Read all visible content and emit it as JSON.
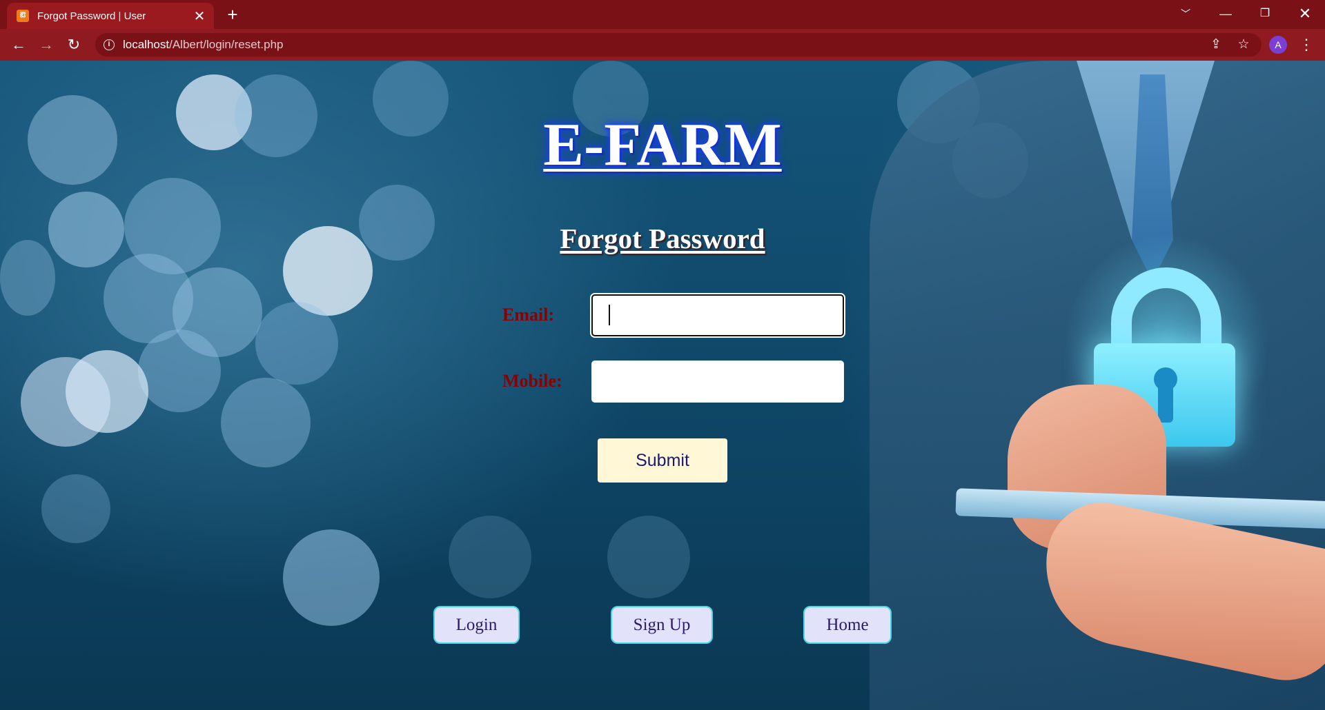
{
  "browser": {
    "tab_title": "Forgot Password | User",
    "tab_close": "✕",
    "new_tab": "+",
    "url_host": "localhost",
    "url_path": "/Albert/login/reset.php",
    "profile_initial": "A",
    "icons": [
      "back-icon",
      "forward-icon",
      "reload-icon",
      "site-info-icon",
      "share-icon",
      "bookmark-star-icon",
      "menu-dots-icon",
      "tab-search-icon",
      "minimize-icon",
      "restore-icon",
      "close-window-icon"
    ],
    "colors": {
      "tabbar": "#7a1117",
      "toolbar": "#8f1a1f"
    }
  },
  "page": {
    "brand": "E-FARM",
    "heading": "Forgot Password",
    "form": {
      "email_label": "Email:",
      "email_value": "",
      "mobile_label": "Mobile:",
      "mobile_value": "",
      "submit_label": "Submit"
    },
    "nav": {
      "login": "Login",
      "signup": "Sign Up",
      "home": "Home"
    },
    "colors": {
      "label": "#8b0000",
      "submit_bg": "#fff7d6",
      "pill_bg": "#e2e2fa",
      "pill_border": "#47d7e6"
    }
  }
}
